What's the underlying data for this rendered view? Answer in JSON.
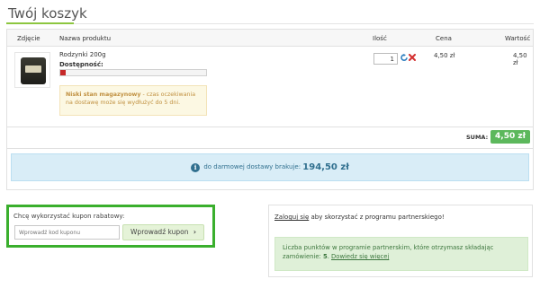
{
  "page_title": "Twój koszyk",
  "table": {
    "headers": {
      "image": "Zdjęcie",
      "name": "Nazwa produktu",
      "qty": "Ilość",
      "price": "Cena",
      "value": "Wartość"
    },
    "item": {
      "name": "Rodzynki 200g",
      "availability_label": "Dostępność:",
      "availability_level": 0.04,
      "stock_alert_bold": "Niski stan magazynowy",
      "stock_alert_text": " - czas oczekiwania na dostawę może się wydłużyć do 5 dni.",
      "quantity": "1",
      "price": "4,50 zł",
      "value": "4,50 zł"
    }
  },
  "summary": {
    "label": "SUMA:",
    "total": "4,50 zł"
  },
  "shipping": {
    "text": "do darmowej dostawy brakuje:",
    "amount": "194,50 zł"
  },
  "coupon": {
    "label": "Chcę wykorzystać kupon rabatowy:",
    "placeholder": "Wprowadź kod kuponu",
    "button_label": "Wprowadź kupon"
  },
  "partner": {
    "login_link": "Zaloguj się",
    "login_text": " aby skorzystać z programu partnerskiego!",
    "info_text": "Liczba punktów w programie partnerskim, które otrzymasz składając zamówienie: ",
    "points": "5",
    "more_link": "Dowiedz się więcej"
  },
  "colors": {
    "accent": "#8cc63f",
    "coupon_border": "#3aaf2d",
    "sum_badge": "#5cb85c",
    "danger": "#c62828"
  }
}
